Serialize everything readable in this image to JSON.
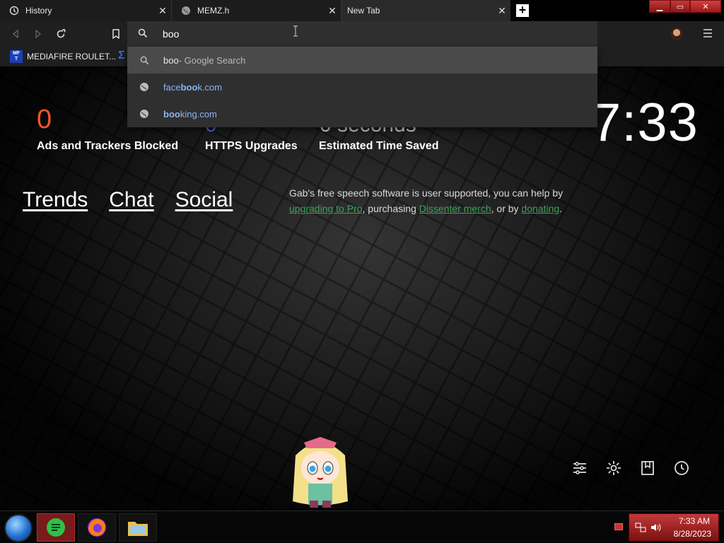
{
  "tabs": [
    {
      "label": "History"
    },
    {
      "label": "MEMZ.h"
    },
    {
      "label": "New Tab"
    }
  ],
  "omnibox": {
    "value": "boo"
  },
  "bookmarks": [
    {
      "label": "MEDIAFIRE ROULET..."
    }
  ],
  "suggestions": [
    {
      "query": "boo",
      "suffix": " - Google Search"
    },
    {
      "pre": "face",
      "match": "boo",
      "post": "k.com"
    },
    {
      "pre": "",
      "match": "boo",
      "post": "king.com"
    }
  ],
  "stats": {
    "ads_blocked": "0",
    "ads_label": "Ads and Trackers Blocked",
    "https_label": "HTTPS Upgrades",
    "time_label": "Estimated Time Saved",
    "time_partial": "0 seconds"
  },
  "clock": "7:33",
  "nav_links": [
    "Trends",
    "Chat",
    "Social"
  ],
  "gab": {
    "t1": "Gab's free speech software is user supported, you can help by ",
    "l1": "upgrading to Pro",
    "t2": ", purchasing ",
    "l2": "Dissenter merch",
    "t3": ", or by ",
    "l3": "donating",
    "t4": "."
  },
  "tray": {
    "time": "7:33 AM",
    "date": "8/28/2023"
  },
  "colors": {
    "accent_orange": "#fb542b",
    "link_blue": "#8ab4f8",
    "gab_green": "#3ca35a",
    "win_red": "#c23a3a"
  }
}
